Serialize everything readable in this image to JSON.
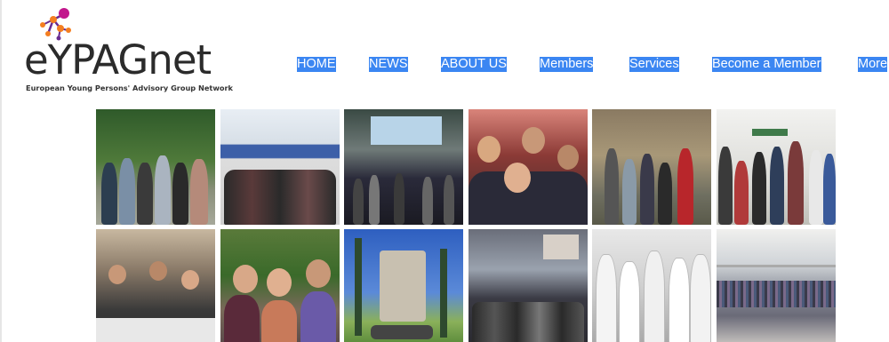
{
  "brand": {
    "logo_text": "eYPAGnet",
    "tagline": "European Young Persons' Advisory Group Network",
    "colors": {
      "accent": "#f47e20",
      "purple": "#6a2c91",
      "magenta": "#c2178c",
      "text": "#2b2b2b"
    }
  },
  "nav": {
    "items": [
      {
        "label": "HOME"
      },
      {
        "label": "NEWS"
      },
      {
        "label": "ABOUT US"
      },
      {
        "label": "Members"
      },
      {
        "label": "Services"
      },
      {
        "label": "Become a Member"
      },
      {
        "label": "More"
      }
    ],
    "highlight_color": "#3b86f2"
  },
  "gallery": {
    "photos": [
      {
        "name": "group-photo-forest"
      },
      {
        "name": "group-photo-stage-banner"
      },
      {
        "name": "conference-stage-presentation"
      },
      {
        "name": "audience-close-up"
      },
      {
        "name": "group-photo-old-building"
      },
      {
        "name": "group-photo-hallway"
      },
      {
        "name": "workshop-table"
      },
      {
        "name": "group-photo-outdoors"
      },
      {
        "name": "giraffe-statues-building"
      },
      {
        "name": "stage-group-photo"
      },
      {
        "name": "lab-coats-visit"
      },
      {
        "name": "large-hall-group-photo"
      }
    ]
  }
}
